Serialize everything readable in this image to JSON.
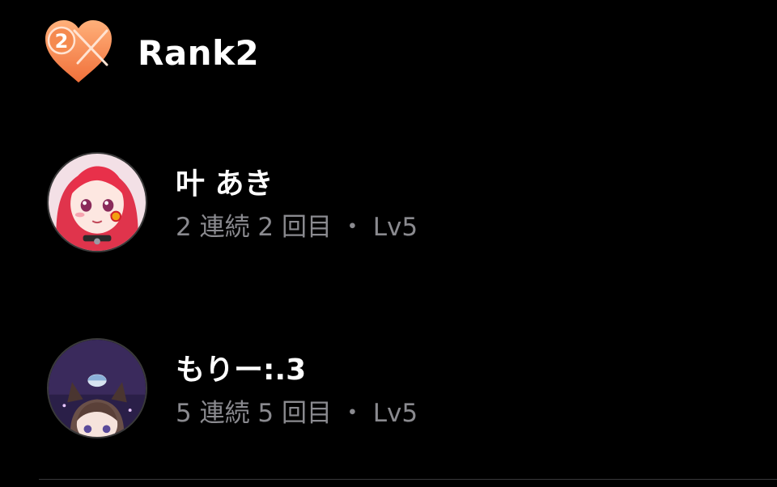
{
  "rank": {
    "badge_number": "2",
    "title": "Rank2",
    "badge_color": "#f58a4f",
    "icon": "heart-badge-icon"
  },
  "users": [
    {
      "name": "叶 あき",
      "meta": "2 連続 2 回目 ・ Lv5",
      "avatar_icon": "avatar-image"
    },
    {
      "name": "もりー:.3",
      "meta": "5 連続 5 回目 ・ Lv5",
      "avatar_icon": "avatar-image"
    }
  ],
  "colors": {
    "background": "#000000",
    "primary_text": "#ffffff",
    "secondary_text": "#8a8a8f",
    "divider": "#3a3a3c"
  }
}
